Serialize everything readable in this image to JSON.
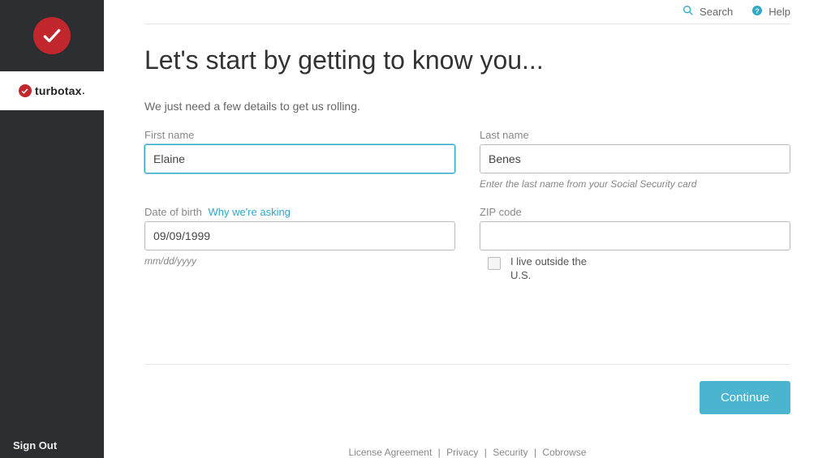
{
  "sidebar": {
    "brand_name": "turbotax",
    "sign_out_label": "Sign Out"
  },
  "topbar": {
    "search_label": "Search",
    "help_label": "Help"
  },
  "page": {
    "heading": "Let's start by getting to know you...",
    "subtitle": "We just need a few details to get us rolling."
  },
  "form": {
    "first_name": {
      "label": "First name",
      "value": "Elaine"
    },
    "last_name": {
      "label": "Last name",
      "value": "Benes",
      "hint": "Enter the last name from your Social Security card"
    },
    "dob": {
      "label": "Date of birth",
      "info_link": "Why we're asking",
      "value": "09/09/1999",
      "hint": "mm/dd/yyyy"
    },
    "zip": {
      "label": "ZIP code",
      "value": "",
      "checkbox_label": "I live outside the U.S."
    }
  },
  "actions": {
    "continue_label": "Continue"
  },
  "footer": {
    "license": "License Agreement",
    "privacy": "Privacy",
    "security": "Security",
    "cobrowse": "Cobrowse"
  }
}
